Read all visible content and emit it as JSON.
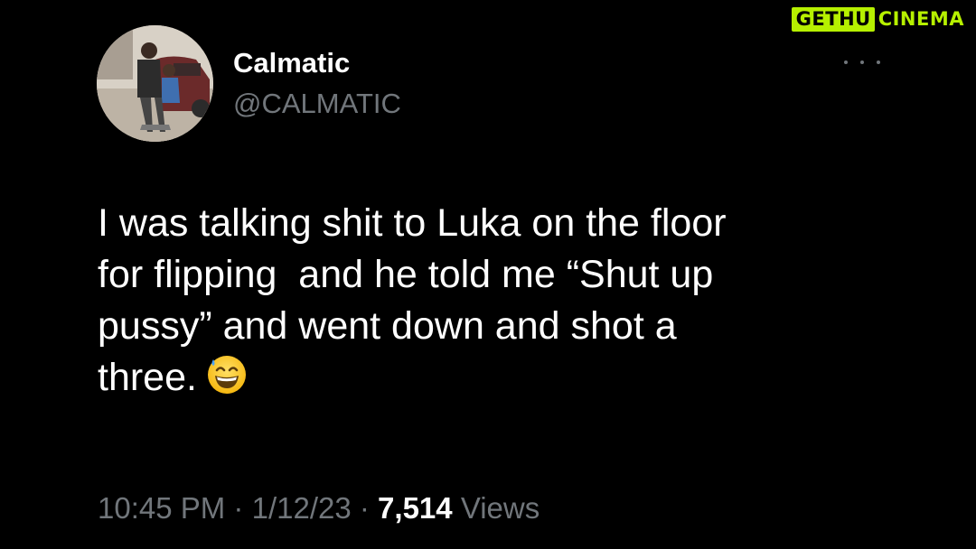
{
  "watermark": {
    "part1": "GETHU",
    "part2": "CINEMA",
    "accent_color": "#b6f000"
  },
  "tweet": {
    "author": {
      "name": "Calmatic",
      "handle": "@CALMATIC",
      "avatar": "profile-photo"
    },
    "more_icon": "more-horizontal-icon",
    "text_lines": [
      "I was talking shit to Luka on the floor",
      "for flipping  and he told me “Shut up",
      "pussy” and went down and shot a",
      "three."
    ],
    "emoji": "grinning-face-with-sweat",
    "time": "10:45 PM",
    "separator": "·",
    "date": "1/12/23",
    "views_count": "7,514",
    "views_label": "Views"
  },
  "colors": {
    "background": "#000000",
    "text_primary": "#ffffff",
    "text_secondary": "#71767b"
  }
}
